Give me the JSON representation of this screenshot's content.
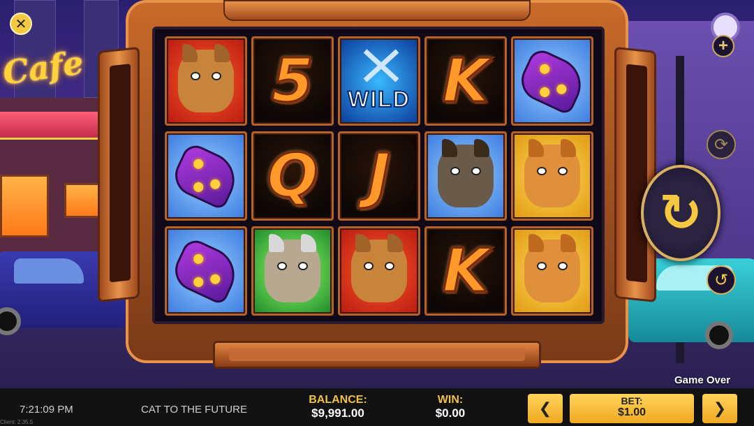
{
  "scene": {
    "cafe_sign": "Cafe"
  },
  "buttons": {
    "close": "✕",
    "plus": "+",
    "spin": "↻",
    "autoplay": "⟳",
    "quick_spin": "↺",
    "bet_down": "❮",
    "bet_up": "❯"
  },
  "reels": {
    "rows": [
      [
        "cat-boss",
        "5",
        "WILD",
        "K",
        "gadget"
      ],
      [
        "gadget",
        "Q",
        "J",
        "dog",
        "cat-girl"
      ],
      [
        "gadget",
        "scientist",
        "cat-boss",
        "K",
        "cat-girl"
      ]
    ],
    "wild_label": "WILD"
  },
  "status": {
    "game_over": "Game Over"
  },
  "bottom_bar": {
    "clock": "7:21:09 PM",
    "version": "Client: 2.35.5",
    "game_title": "CAT TO THE FUTURE",
    "balance_label": "BALANCE:",
    "balance_value": "$9,991.00",
    "win_label": "WIN:",
    "win_value": "$0.00",
    "bet_label": "BET:",
    "bet_value": "$1.00"
  },
  "colors": {
    "accent_gold": "#f0c24a",
    "frame_copper": "#c86a2a",
    "bar_bg": "#121212"
  }
}
